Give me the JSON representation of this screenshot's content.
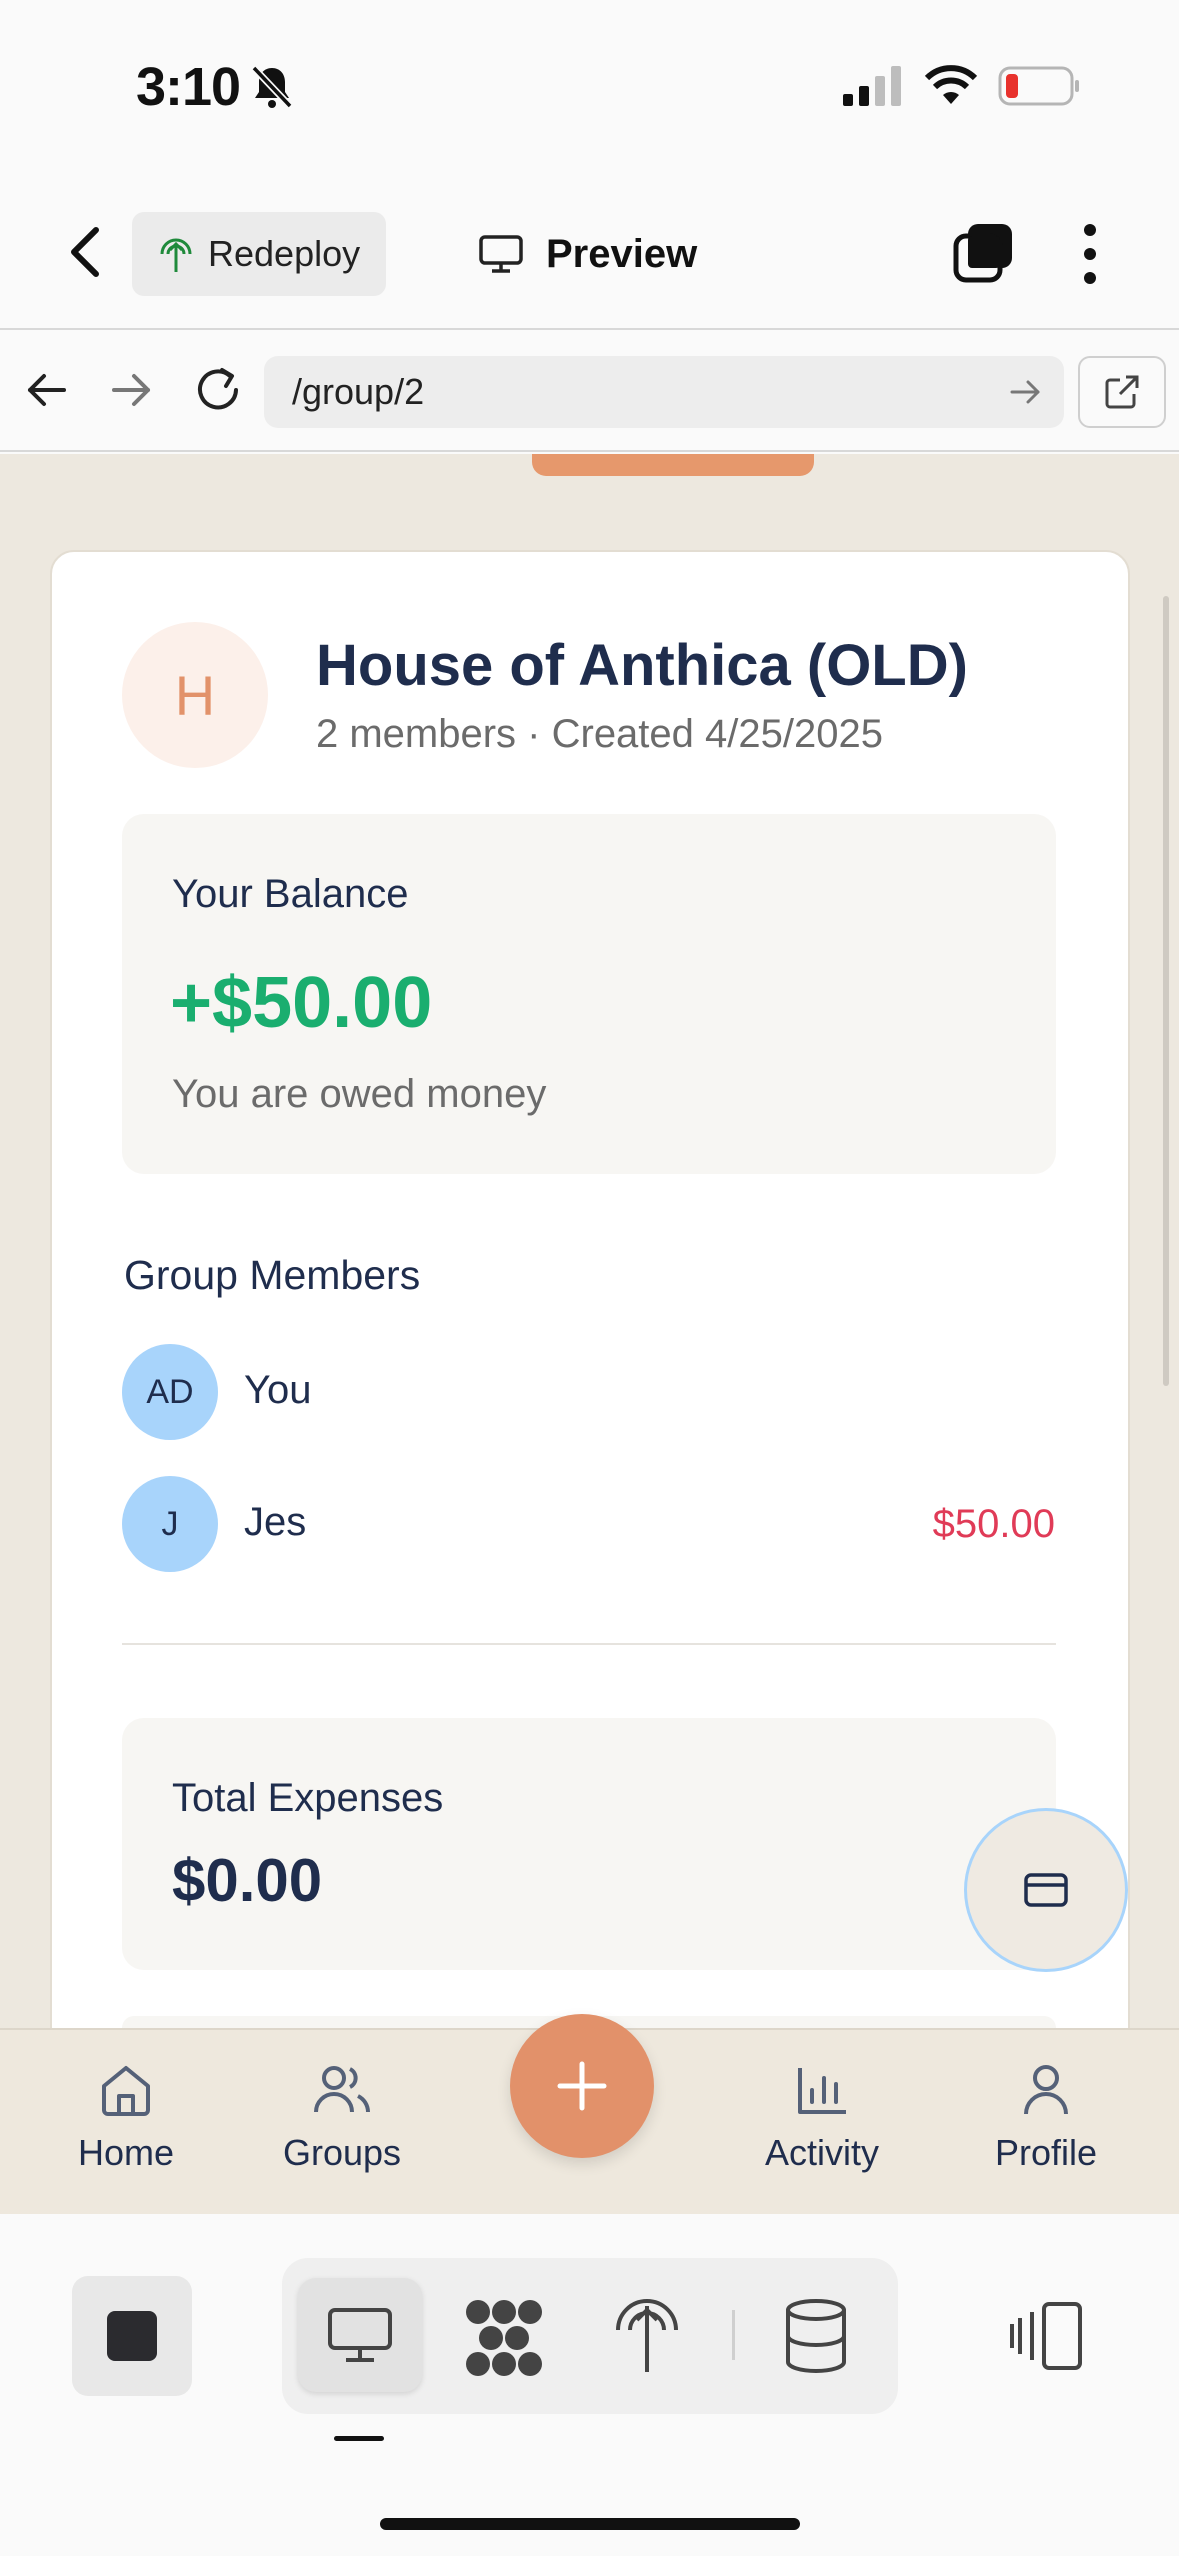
{
  "status_bar": {
    "time": "3:10"
  },
  "header": {
    "redeploy_label": "Redeploy",
    "preview_label": "Preview"
  },
  "browser": {
    "url": "/group/2"
  },
  "group": {
    "avatar_letter": "H",
    "title": "House of Anthica (OLD)",
    "meta": "2 members · Created 4/25/2025"
  },
  "balance": {
    "label": "Your Balance",
    "amount": "+$50.00",
    "note": "You are owed money",
    "color": "#1aae6f"
  },
  "members": {
    "heading": "Group Members",
    "items": [
      {
        "initials": "AD",
        "name": "You",
        "amount": ""
      },
      {
        "initials": "J",
        "name": "Jes",
        "amount": "$50.00"
      }
    ],
    "owed_color": "#e03b57"
  },
  "expenses": {
    "label": "Total Expenses",
    "amount": "$0.00"
  },
  "app_nav": {
    "items": [
      {
        "label": "Home",
        "icon": "home-icon"
      },
      {
        "label": "Groups",
        "icon": "users-icon"
      },
      {
        "label": "Activity",
        "icon": "bar-chart-icon"
      },
      {
        "label": "Profile",
        "icon": "user-icon"
      }
    ],
    "add_icon": "plus-icon",
    "accent": "#e2916a"
  },
  "toolbar": {
    "icons": [
      "stop-icon",
      "desktop-icon",
      "graph-icon",
      "deploy-icon",
      "database-icon",
      "panels-icon"
    ]
  }
}
